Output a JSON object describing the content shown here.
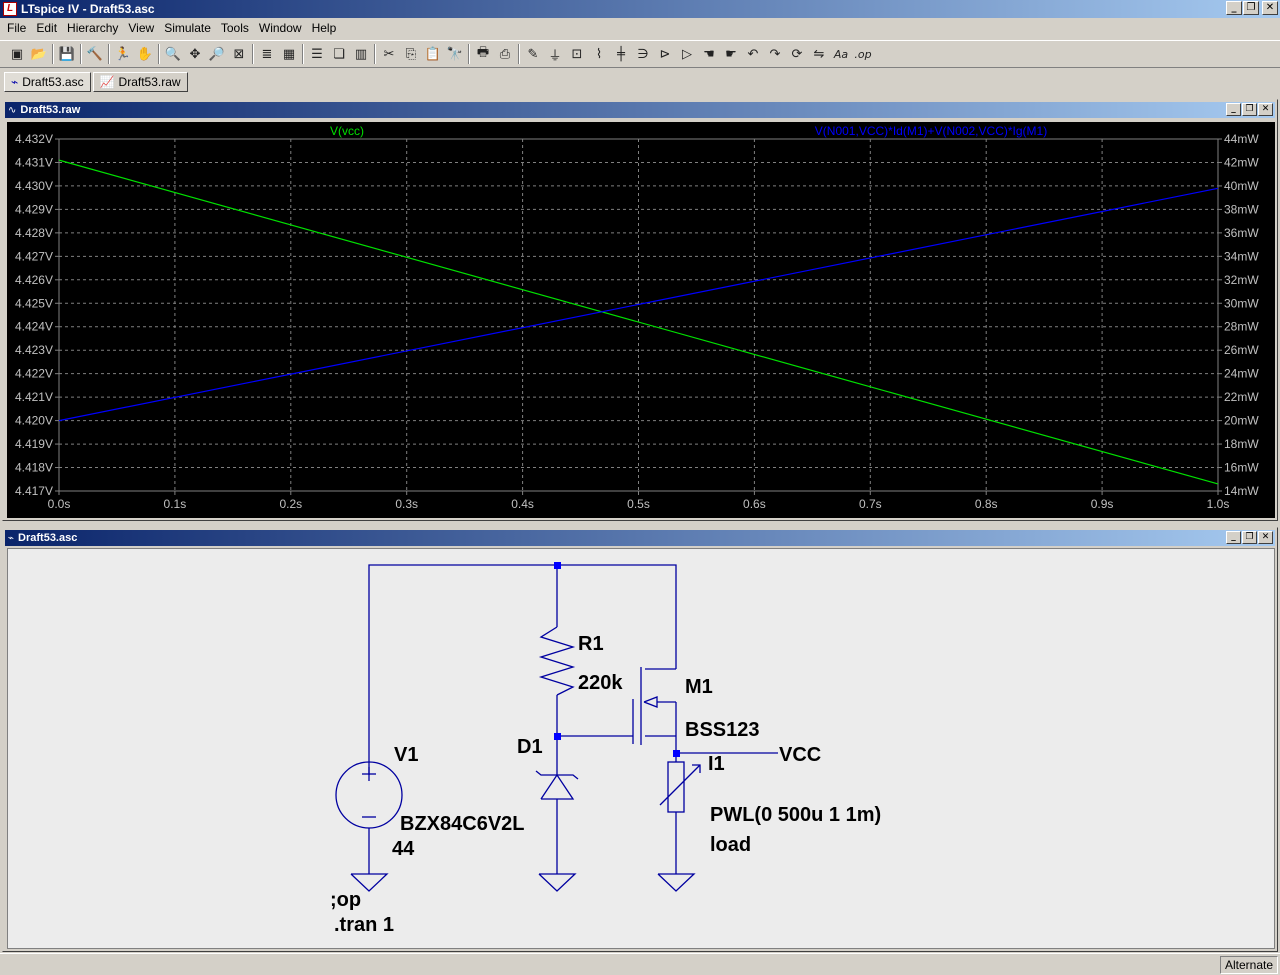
{
  "app": {
    "title": "LTspice IV - Draft53.asc",
    "icon_name": "ltspice-logo-icon",
    "icon_letter": "L"
  },
  "window_buttons": {
    "minimize": "_",
    "restore": "❐",
    "close": "✕"
  },
  "menu": [
    "File",
    "Edit",
    "Hierarchy",
    "View",
    "Simulate",
    "Tools",
    "Window",
    "Help"
  ],
  "toolbar": {
    "groups": [
      [
        "new-schematic-icon",
        "open-icon"
      ],
      [
        "save-icon"
      ],
      [
        "control-panel-icon"
      ],
      [
        "run-icon",
        "halt-icon"
      ],
      [
        "zoom-in-icon",
        "pan-icon",
        "zoom-out-icon",
        "zoom-fit-icon"
      ],
      [
        "autorange-icon",
        "grid-icon"
      ],
      [
        "tile-horizontal-icon",
        "cascade-icon",
        "tile-vertical-icon"
      ],
      [
        "cut-icon",
        "copy-icon",
        "paste-icon",
        "find-icon"
      ],
      [
        "print-preview-icon",
        "print-icon"
      ],
      [
        "draw-wire-icon",
        "ground-icon",
        "label-net-icon",
        "resistor-icon",
        "capacitor-icon",
        "inductor-icon",
        "diode-icon",
        "component-icon",
        "move-icon",
        "drag-icon",
        "undo-icon",
        "redo-icon",
        "rotate-icon",
        "mirror-icon",
        "text-icon",
        "spice-directive-icon"
      ]
    ],
    "glyphs": {
      "new-schematic-icon": "▣",
      "open-icon": "📂",
      "save-icon": "💾",
      "control-panel-icon": "🔨",
      "run-icon": "🏃",
      "halt-icon": "✋",
      "zoom-in-icon": "🔍",
      "pan-icon": "✥",
      "zoom-out-icon": "🔎",
      "zoom-fit-icon": "⊠",
      "autorange-icon": "≣",
      "grid-icon": "▦",
      "tile-horizontal-icon": "☰",
      "cascade-icon": "❏",
      "tile-vertical-icon": "▥",
      "cut-icon": "✂",
      "copy-icon": "⎘",
      "paste-icon": "📋",
      "find-icon": "🔭",
      "print-preview-icon": "🖶",
      "print-icon": "⎙",
      "draw-wire-icon": "✎",
      "ground-icon": "⏚",
      "label-net-icon": "⊡",
      "resistor-icon": "⌇",
      "capacitor-icon": "╪",
      "inductor-icon": "∋",
      "diode-icon": "⊳",
      "component-icon": "▷",
      "move-icon": "☚",
      "drag-icon": "☛",
      "undo-icon": "↶",
      "redo-icon": "↷",
      "rotate-icon": "⟳",
      "mirror-icon": "⇋",
      "text-icon": "Aa",
      "spice-directive-icon": ".op"
    }
  },
  "tabs": [
    {
      "label": "Draft53.asc",
      "icon": "schematic-icon",
      "glyph": "⌁",
      "active": true
    },
    {
      "label": "Draft53.raw",
      "icon": "waveform-icon",
      "glyph": "📈",
      "active": false
    }
  ],
  "plot_window": {
    "title": "Draft53.raw",
    "icon": "waveform-icon",
    "icon_glyph": "∿"
  },
  "chart_data": {
    "type": "line",
    "background": "#000000",
    "grid": true,
    "grid_color": "#808080",
    "x": {
      "ticks": [
        0,
        0.1,
        0.2,
        0.3,
        0.4,
        0.5,
        0.6,
        0.7,
        0.8,
        0.9,
        1.0
      ],
      "tick_labels": [
        "0.0s",
        "0.1s",
        "0.2s",
        "0.3s",
        "0.4s",
        "0.5s",
        "0.6s",
        "0.7s",
        "0.8s",
        "0.9s",
        "1.0s"
      ],
      "range": [
        0,
        1.0
      ]
    },
    "y_left": {
      "ticks": [
        4.417,
        4.418,
        4.419,
        4.42,
        4.421,
        4.422,
        4.423,
        4.424,
        4.425,
        4.426,
        4.427,
        4.428,
        4.429,
        4.43,
        4.431,
        4.432
      ],
      "tick_labels": [
        "4.417V",
        "4.418V",
        "4.419V",
        "4.420V",
        "4.421V",
        "4.422V",
        "4.423V",
        "4.424V",
        "4.425V",
        "4.426V",
        "4.427V",
        "4.428V",
        "4.429V",
        "4.430V",
        "4.431V",
        "4.432V"
      ],
      "range": [
        4.417,
        4.432
      ]
    },
    "y_right": {
      "ticks": [
        14,
        16,
        18,
        20,
        22,
        24,
        26,
        28,
        30,
        32,
        34,
        36,
        38,
        40,
        42,
        44
      ],
      "tick_labels": [
        "14mW",
        "16mW",
        "18mW",
        "20mW",
        "22mW",
        "24mW",
        "26mW",
        "28mW",
        "30mW",
        "32mW",
        "34mW",
        "36mW",
        "38mW",
        "40mW",
        "42mW",
        "44mW"
      ],
      "range": [
        14,
        44
      ]
    },
    "series": [
      {
        "name": "V(vcc)",
        "axis": "left",
        "color": "#00e000",
        "x": [
          0.0,
          1.0
        ],
        "y": [
          4.4311,
          4.4173
        ]
      },
      {
        "name": "V(N001,VCC)*Id(M1)+V(N002,VCC)*Ig(M1)",
        "axis": "right",
        "color": "#0000ff",
        "x": [
          0.0,
          1.0
        ],
        "y": [
          20.0,
          39.8
        ]
      }
    ],
    "label_color": "#c0c0c0"
  },
  "schematic_window": {
    "title": "Draft53.asc",
    "icon": "schematic-icon",
    "icon_glyph": "⌁"
  },
  "schematic": {
    "wire_color": "#0000a0",
    "junction_color": "#0000ff",
    "labels": {
      "r1_name": "R1",
      "r1_value": "220k",
      "m1_name": "M1",
      "m1_value": "BSS123",
      "d1_name": "D1",
      "v1_name": "V1",
      "v1_value": "BZX84C6V2L",
      "v1_value2": "44",
      "i1_name": "I1",
      "i1_value": "PWL(0 500u 1 1m)",
      "i1_value2": "load",
      "net_vcc": "VCC",
      "directive1": ";op",
      "directive2": ".tran 1"
    }
  },
  "status": {
    "mode": "Alternate"
  }
}
